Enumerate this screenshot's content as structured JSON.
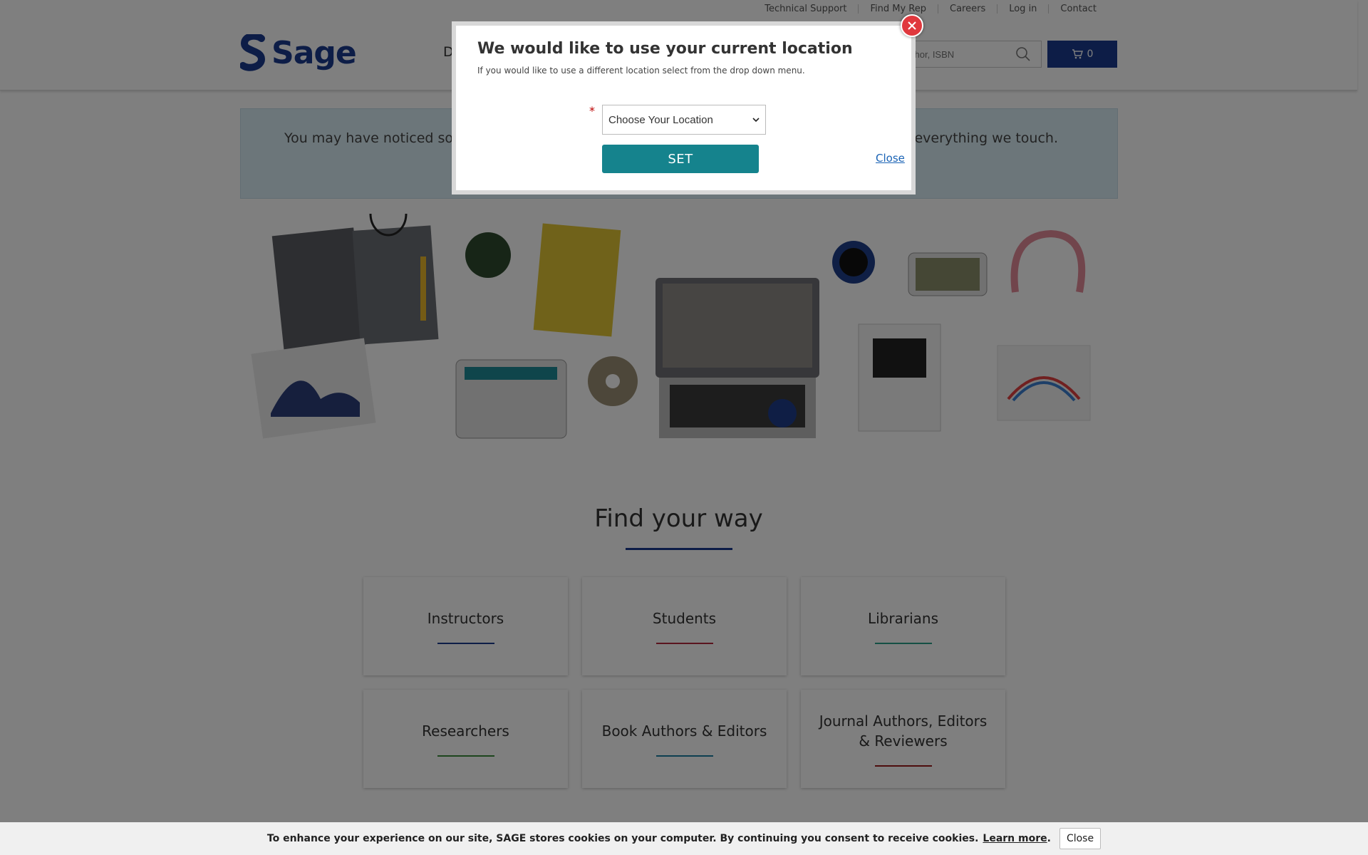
{
  "utility_nav": [
    "Technical Support",
    "Find My Rep",
    "Careers",
    "Log in",
    "Contact"
  ],
  "header": {
    "logo_text": "Sage",
    "nav_partial": "D",
    "search_placeholder": "e, author, ISBN",
    "cart_count": "0"
  },
  "notice": {
    "text_left": "You may have noticed some",
    "text_right": "nto everything we touch."
  },
  "find_your_way": {
    "title": "Find your way",
    "cards": [
      {
        "label": "Instructors",
        "color": "#1a3a8f"
      },
      {
        "label": "Students",
        "color": "#b5283d"
      },
      {
        "label": "Librarians",
        "color": "#2aa189"
      },
      {
        "label": "Researchers",
        "color": "#3a8a3a"
      },
      {
        "label": "Book Authors & Editors",
        "color": "#1a7fa3"
      },
      {
        "label": "Journal Authors, Editors & Reviewers",
        "color": "#9b1b1b"
      }
    ]
  },
  "location_modal": {
    "title": "We would like to use your current location",
    "subtitle": "If you would like to use a different location select from the drop down menu.",
    "required_mark": "*",
    "select_value": "Choose Your Location",
    "set_label": "SET",
    "close_label": "Close"
  },
  "cookie_bar": {
    "text": "To enhance your experience on our site, SAGE stores cookies on your computer. By continuing you consent to receive cookies.",
    "learn_more": "Learn more",
    "period": ".",
    "close_label": "Close"
  },
  "colors": {
    "brand_blue": "#1a3a8f",
    "set_button": "#15838d",
    "modal_close": "#e0383e"
  }
}
